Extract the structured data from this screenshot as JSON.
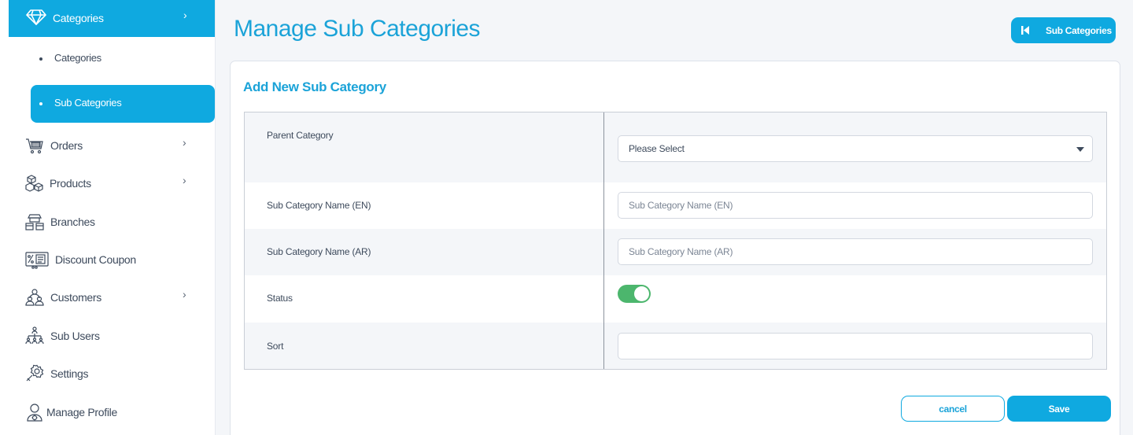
{
  "sidebar": {
    "categories_group": {
      "label": "Categories",
      "icon": "diamond-icon",
      "chevron": "›"
    },
    "sub_items": [
      {
        "label": "Categories",
        "active": false
      },
      {
        "label": "Sub Categories",
        "active": true
      }
    ],
    "items": [
      {
        "label": "Orders",
        "icon": "shopping-cart-icon",
        "chevron": "›"
      },
      {
        "label": "Products",
        "icon": "boxes-icon",
        "chevron": "›"
      },
      {
        "label": "Branches",
        "icon": "store-icon",
        "chevron": ""
      },
      {
        "label": "Discount Coupon",
        "icon": "coupon-icon",
        "chevron": ""
      },
      {
        "label": "Customers",
        "icon": "customers-icon",
        "chevron": "›"
      },
      {
        "label": "Sub Users",
        "icon": "hierarchy-icon",
        "chevron": ""
      },
      {
        "label": "Settings",
        "icon": "gear-icon",
        "chevron": ""
      },
      {
        "label": "Manage Profile",
        "icon": "profile-icon",
        "chevron": ""
      }
    ]
  },
  "header": {
    "title": "Manage Sub Categories",
    "back_button_label": "Sub Categories"
  },
  "form": {
    "title": "Add New Sub Category",
    "parent_category": {
      "label": "Parent Category",
      "value": "Please Select"
    },
    "name_en": {
      "label": "Sub Category Name (EN)",
      "placeholder": "Sub Category Name (EN)",
      "value": ""
    },
    "name_ar": {
      "label": "Sub Category Name (AR)",
      "placeholder": "Sub Category Name (AR)",
      "value": ""
    },
    "status": {
      "label": "Status",
      "enabled": true
    },
    "sort": {
      "label": "Sort",
      "value": ""
    },
    "cancel_label": "cancel",
    "save_label": "Save"
  },
  "colors": {
    "accent": "#0fa9e0",
    "title": "#1ba3d8",
    "toggle_on": "#4cb66d",
    "text": "#3d4a5c"
  }
}
